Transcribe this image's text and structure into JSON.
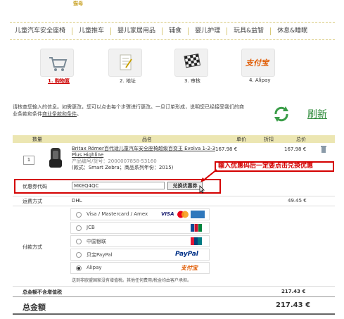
{
  "logo_text": "猫母",
  "nav": [
    "儿童汽车安全座椅",
    "儿童推车",
    "婴儿家居用品",
    "辅食",
    "婴儿护理",
    "玩具&益智",
    "休息&睡眠"
  ],
  "steps": [
    {
      "label": "1. 购物篮",
      "icon": "cart-icon"
    },
    {
      "label": "2. 地址",
      "icon": "notepad-icon"
    },
    {
      "label": "3. 审核",
      "icon": "checkered-flag-icon"
    },
    {
      "label": "4. Alipay",
      "icon": "alipay-icon"
    }
  ],
  "description": "请核查您输入的信息。如需更改，您可以点击每个步骤进行更改。一旦订单形成，说明您已经接受我们的商业条款和条件",
  "description_link": "商业条款和条件",
  "refresh_label": "刷新",
  "table_headers": {
    "qty": "数量",
    "product": "品名",
    "unit_price": "单价",
    "discount": "折扣",
    "total": "总价"
  },
  "item": {
    "qty": "1",
    "name": "Britax Römer百代适儿童汽车安全座椅超级百变王 Evolva 1-2-3 Plus Highline",
    "code": "产品编号/货号：2000007858-53160",
    "style": "(款式：Smart Zebra；商品系列年份：2015)",
    "unit_price": "167.98 €",
    "total": "167.98 €"
  },
  "annotation": "输入优惠码后一定要点击兑换优惠",
  "coupon": {
    "label": "优惠券代码",
    "value": "MKEQ4QC",
    "button": "兑换优惠券"
  },
  "shipping": {
    "label": "运费方式",
    "method": "DHL",
    "price": "49.45 €"
  },
  "payment_label": "付款方式",
  "payment_options": [
    {
      "label": "Visa / Mastercard / Amex",
      "icons": [
        "VISA",
        "MC",
        "AMEX"
      ]
    },
    {
      "label": "JCB",
      "icons": [
        "JCB"
      ]
    },
    {
      "label": "中国银联",
      "icons": [
        "UnionPay"
      ]
    },
    {
      "label": "贝宝PayPal",
      "icons": [
        "PayPal"
      ]
    },
    {
      "label": "Alipay",
      "icons": [
        "支付宝"
      ]
    }
  ],
  "tax_note": "送到非欧盟国家没有增值税。其他任何费用/税金均由客户承担。",
  "totals": {
    "net_label": "总金额不含增值税",
    "net_value": "217.43 €",
    "gross_label": "总金额",
    "gross_value": "217.43 €"
  },
  "colors": {
    "accent_green": "#2e8b3a",
    "header_bg": "#ece6b2",
    "annotation_red": "#d40000"
  }
}
